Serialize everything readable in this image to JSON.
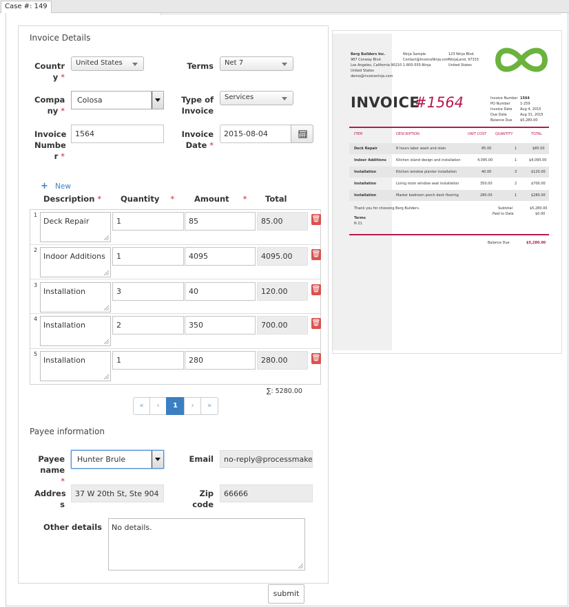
{
  "tab": {
    "case_label": "Case #: 149"
  },
  "invoice_details": {
    "title": "Invoice Details",
    "country": {
      "label": "Country",
      "value": "United States"
    },
    "terms": {
      "label": "Terms",
      "value": "Net 7"
    },
    "company": {
      "label": "Company",
      "value": "Colosa"
    },
    "type_of_invoice": {
      "label": "Type of Invoice",
      "value": "Services"
    },
    "invoice_number": {
      "label": "Invoice Number",
      "value": "1564"
    },
    "invoice_date": {
      "label": "Invoice Date",
      "value": "2015-08-04"
    }
  },
  "items": {
    "new_label": "New",
    "headers": {
      "description": "Description",
      "quantity": "Quantity",
      "amount": "Amount",
      "total": "Total"
    },
    "rows": [
      {
        "num": "1",
        "description": "Deck Repair",
        "quantity": "1",
        "amount": "85",
        "total": "85.00"
      },
      {
        "num": "2",
        "description": "Indoor Additions",
        "quantity": "1",
        "amount": "4095",
        "total": "4095.00"
      },
      {
        "num": "3",
        "description": "Installation",
        "quantity": "3",
        "amount": "40",
        "total": "120.00"
      },
      {
        "num": "4",
        "description": "Installation",
        "quantity": "2",
        "amount": "350",
        "total": "700.00"
      },
      {
        "num": "5",
        "description": "Installation",
        "quantity": "1",
        "amount": "280",
        "total": "280.00"
      }
    ],
    "sum": "∑: 5280.00",
    "pager": {
      "first": "«",
      "prev": "‹",
      "current": "1",
      "next": "›",
      "last": "»"
    }
  },
  "payee": {
    "title": "Payee information",
    "name": {
      "label": "Payee name",
      "value": "Hunter Brule"
    },
    "email": {
      "label": "Email",
      "value": "no-reply@processmaker.co"
    },
    "address": {
      "label": "Address",
      "value": "37 W 20th St, Ste 904"
    },
    "zip": {
      "label": "Zip code",
      "value": "66666"
    },
    "other": {
      "label": "Other details",
      "value": "No details."
    }
  },
  "submit_label": "submit",
  "preview": {
    "from": {
      "name": "Berg Builders Inc.",
      "line1": "987 Conway Blvd.",
      "line2": "Los Angeles, California 90210",
      "line3": "United States",
      "line4": "demo@invoiceninja.com"
    },
    "contact": {
      "line1": "Ninja Sample",
      "line2": "Contact@InvoiceNinja.com",
      "line3": "1-800-555-Ninja"
    },
    "addr": {
      "line1": "123 Ninja Blvd.",
      "line2": "NinjaLand, 97315",
      "line3": "United States"
    },
    "invoice_word": "INVOICE",
    "invoice_num": "#1564",
    "meta": [
      {
        "k": "Invoice Number",
        "v": "1564"
      },
      {
        "k": "PO Number",
        "v": "1-259"
      },
      {
        "k": "Invoice Date",
        "v": "Aug 4, 2015"
      },
      {
        "k": "Due Date",
        "v": "Aug 31, 2015"
      },
      {
        "k": "Balance Due",
        "v": "$5,280.00"
      }
    ],
    "cols": {
      "item": "ITEM",
      "desc": "DESCRIPTION",
      "unit": "UNIT COST",
      "qty": "QUANTITY",
      "total": "TOTAL"
    },
    "lines": [
      {
        "item": "Deck Repair",
        "desc": "8 hours labor wash and stain",
        "unit": "85.00",
        "qty": "1",
        "total": "$85.00"
      },
      {
        "item": "Indoor Additions",
        "desc": "Kitchen island design and installation",
        "unit": "4,095.00",
        "qty": "1",
        "total": "$4,095.00"
      },
      {
        "item": "Installation",
        "desc": "Kitchen window planter installation",
        "unit": "40.00",
        "qty": "3",
        "total": "$120.00"
      },
      {
        "item": "Installation",
        "desc": "Living room window seat installation",
        "unit": "350.00",
        "qty": "2",
        "total": "$700.00"
      },
      {
        "item": "Installation",
        "desc": "Master bedroom porch deck flooring",
        "unit": "280.00",
        "qty": "1",
        "total": "$280.00"
      }
    ],
    "thanks": "Thank you for choosing Berg Builders.",
    "terms_label": "Terms",
    "terms_value": "N 21",
    "subtotal_label": "Subtotal",
    "subtotal_value": "$5,280.00",
    "paid_label": "Paid to Date",
    "paid_value": "$0.00",
    "balance_label": "Balance Due",
    "balance_value": "$5,280.00",
    "accent": "#b5174d",
    "logo_green": "#6bb33d"
  }
}
